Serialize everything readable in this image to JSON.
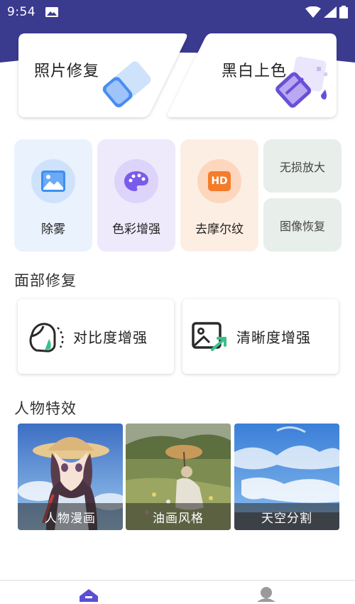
{
  "status_bar": {
    "time": "9:54",
    "picture_icon": "image-icon",
    "icons": [
      "wifi-icon",
      "signal-icon",
      "battery-icon"
    ]
  },
  "colors": {
    "brand": "#3a3a8f",
    "dehaze_bg": "#eaf2fd",
    "color_bg": "#eeeafc",
    "moire_bg": "#fdeee3",
    "mini_bg": "#e8eee9"
  },
  "top_cards": {
    "photo_repair": "照片修复",
    "colorize": "黑白上色"
  },
  "tools": {
    "dehaze": "除雾",
    "color_enhance": "色彩增强",
    "demoire": "去摩尔纹",
    "lossless_zoom": "无损放大",
    "image_restore": "图像恢复",
    "hd_badge": "HD"
  },
  "face_section": {
    "title": "面部修复",
    "contrast": "对比度增强",
    "clarity": "清晰度增强"
  },
  "effects_section": {
    "title": "人物特效",
    "items": [
      "人物漫画",
      "油画风格",
      "天空分割"
    ]
  },
  "bottom_nav": {
    "items": [
      "home-icon",
      "profile-icon"
    ]
  }
}
